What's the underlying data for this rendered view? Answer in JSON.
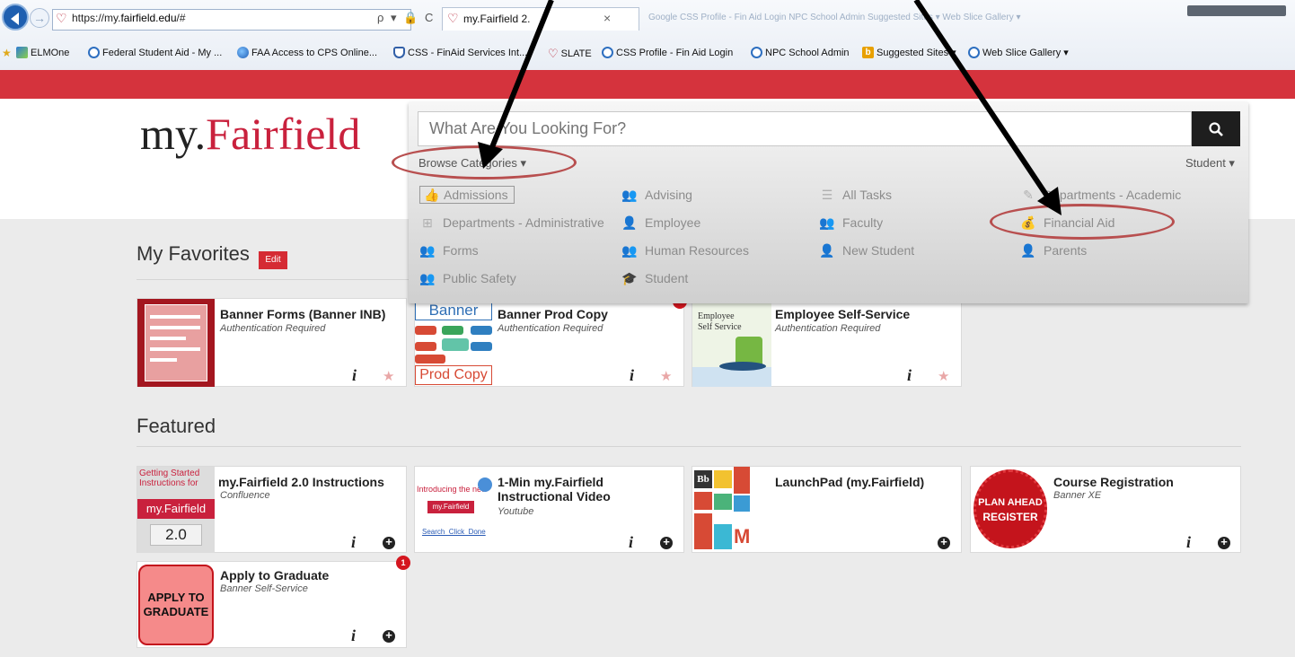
{
  "browser": {
    "url_prefix": "https://my.",
    "url_host": "fairfield.edu",
    "url_suffix": "/#",
    "addr_icons": "ρ ▾ 🔒 C",
    "tab_title": "my.Fairfield 2.",
    "tab_close": "×",
    "faded_tabs": "Google   CSS Profile - Fin Aid Login   NPC School Admin   Suggested Sites ▾   Web Slice Gallery ▾",
    "favorites": [
      "ELMOne",
      "Federal Student Aid - My ...",
      "FAA Access to CPS Online...",
      "CSS - FinAid Services Int...",
      "SLATE",
      "CSS Profile - Fin Aid Login",
      "NPC School Admin",
      "Suggested Sites ▾",
      "Web Slice Gallery ▾"
    ]
  },
  "header": {
    "logo_my": "my.",
    "logo_fairfield": "Fairfield"
  },
  "search": {
    "placeholder": "What Are You Looking For?",
    "browse_label": "Browse Categories ▾",
    "role_label": "Student ▾"
  },
  "categories": [
    {
      "label": "Admissions",
      "icon": "thumbs-up-icon"
    },
    {
      "label": "Advising",
      "icon": "users-icon"
    },
    {
      "label": "All Tasks",
      "icon": "list-icon"
    },
    {
      "label": "Departments - Academic",
      "icon": "pencil-icon"
    },
    {
      "label": "Departments - Administrative",
      "icon": "sitemap-icon"
    },
    {
      "label": "Employee",
      "icon": "user-icon"
    },
    {
      "label": "Faculty",
      "icon": "group-icon"
    },
    {
      "label": "Financial Aid",
      "icon": "money-bag-icon"
    },
    {
      "label": "Forms",
      "icon": "group-icon"
    },
    {
      "label": "Human Resources",
      "icon": "group-icon"
    },
    {
      "label": "New Student",
      "icon": "user-icon"
    },
    {
      "label": "Parents",
      "icon": "user-icon"
    },
    {
      "label": "Public Safety",
      "icon": "group-icon"
    },
    {
      "label": "Student",
      "icon": "student-icon"
    }
  ],
  "favorites_section": {
    "title": "My Favorites",
    "edit_label": "Edit",
    "cards": [
      {
        "title": "Banner Forms (Banner INB)",
        "subtitle": "Authentication Required"
      },
      {
        "title": "Banner Prod Copy",
        "subtitle": "Authentication Required",
        "thumb_top": "Banner",
        "thumb_bottom": "Prod Copy"
      },
      {
        "title": "Employee Self-Service",
        "subtitle": "Authentication Required",
        "thumb_text": "Employee Self Service"
      }
    ]
  },
  "featured_section": {
    "title": "Featured",
    "cards": [
      {
        "title": "my.Fairfield 2.0 Instructions",
        "subtitle": "Confluence",
        "thumb_l1": "Getting Started",
        "thumb_l2": "Instructions for",
        "thumb_l3": "my.Fairfield",
        "thumb_l4": "2.0"
      },
      {
        "title_l1": "1-Min my.Fairfield",
        "title_l2": "Instructional Video",
        "subtitle": "Youtube",
        "thumb_l1": "Introducing the new",
        "thumb_l2": "my.Fairfield",
        "thumb_l3": "Search  Click  Done"
      },
      {
        "title": "LaunchPad (my.Fairfield)",
        "subtitle": "",
        "thumb_l1": "Bb"
      },
      {
        "title": "Course Registration",
        "subtitle": "Banner XE",
        "thumb_l1": "PLAN AHEAD",
        "thumb_l2": "REGISTER"
      },
      {
        "title": "Apply to Graduate",
        "subtitle": "Banner Self-Service",
        "badge": "1",
        "thumb_l1": "APPLY TO",
        "thumb_l2": "GRADUATE"
      }
    ]
  },
  "info_glyph": "i",
  "star_glyph": "★"
}
